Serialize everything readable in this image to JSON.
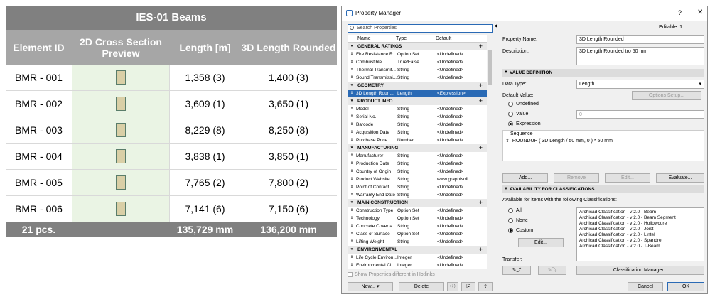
{
  "schedule": {
    "title": "IES-01 Beams",
    "headers": [
      "Element ID",
      "2D Cross Section Preview",
      "Length [m]",
      "3D Length Rounded"
    ],
    "rows": [
      {
        "id": "BMR - 001",
        "length": "1,358 (3)",
        "rounded": "1,400 (3)"
      },
      {
        "id": "BMR - 002",
        "length": "3,609 (1)",
        "rounded": "3,650 (1)"
      },
      {
        "id": "BMR - 003",
        "length": "8,229 (8)",
        "rounded": "8,250 (8)"
      },
      {
        "id": "BMR - 004",
        "length": "3,838 (1)",
        "rounded": "3,850 (1)"
      },
      {
        "id": "BMR - 005",
        "length": "7,765 (2)",
        "rounded": "7,800 (2)"
      },
      {
        "id": "BMR - 006",
        "length": "7,141 (6)",
        "rounded": "7,150 (6)"
      }
    ],
    "footer": {
      "count": "21 pcs.",
      "length_total": "135,729 mm",
      "rounded_total": "136,200 mm"
    }
  },
  "dialog": {
    "title": "Property Manager",
    "help": "?",
    "close": "✕",
    "search_placeholder": "Search Properties",
    "columns": {
      "name": "Name",
      "type": "Type",
      "default": "Default"
    },
    "groups": [
      {
        "label": "GENERAL RATINGS",
        "items": [
          {
            "name": "Fire Resistance R...",
            "type": "Option Set",
            "default": "<Undefined>"
          },
          {
            "name": "Combustible",
            "type": "True/False",
            "default": "<Undefined>"
          },
          {
            "name": "Thermal Transmit...",
            "type": "String",
            "default": "<Undefined>"
          },
          {
            "name": "Sound Transmissi...",
            "type": "String",
            "default": "<Undefined>"
          }
        ]
      },
      {
        "label": "GEOMETRY",
        "items": [
          {
            "name": "3D Length Roun...",
            "type": "Length",
            "default": "<Expression>",
            "selected": true
          }
        ]
      },
      {
        "label": "PRODUCT INFO",
        "items": [
          {
            "name": "Model",
            "type": "String",
            "default": "<Undefined>"
          },
          {
            "name": "Serial No.",
            "type": "String",
            "default": "<Undefined>"
          },
          {
            "name": "Barcode",
            "type": "String",
            "default": "<Undefined>"
          },
          {
            "name": "Acquisition Date",
            "type": "String",
            "default": "<Undefined>"
          },
          {
            "name": "Purchase Price",
            "type": "Number",
            "default": "<Undefined>"
          }
        ]
      },
      {
        "label": "MANUFACTURING",
        "items": [
          {
            "name": "Manufacturer",
            "type": "String",
            "default": "<Undefined>"
          },
          {
            "name": "Production Date",
            "type": "String",
            "default": "<Undefined>"
          },
          {
            "name": "Country of Origin",
            "type": "String",
            "default": "<Undefined>"
          },
          {
            "name": "Product Website",
            "type": "String",
            "default": "www.graphisoft...."
          },
          {
            "name": "Point of Contact",
            "type": "String",
            "default": "<Undefined>"
          },
          {
            "name": "Warranty End Date",
            "type": "String",
            "default": "<Undefined>"
          }
        ]
      },
      {
        "label": "MAIN CONSTRUCTION",
        "items": [
          {
            "name": "Construction Type",
            "type": "Option Set",
            "default": "<Undefined>"
          },
          {
            "name": "Technology",
            "type": "Option Set",
            "default": "<Undefined>"
          },
          {
            "name": "Concrete Cover a...",
            "type": "String",
            "default": "<Undefined>"
          },
          {
            "name": "Class of Surface",
            "type": "Option Set",
            "default": "<Undefined>"
          },
          {
            "name": "Lifting Weight",
            "type": "String",
            "default": "<Undefined>"
          }
        ]
      },
      {
        "label": "ENVIRONMENTAL",
        "items": [
          {
            "name": "Life Cycle Environ...",
            "type": "Integer",
            "default": "<Undefined>"
          },
          {
            "name": "Environmental Cl...",
            "type": "Integer",
            "default": "<Undefined>"
          }
        ]
      }
    ],
    "show_hotlinks": "Show Properties different in Hotlinks",
    "new_button": "New...",
    "delete_button": "Delete",
    "editable": "Editable: 1",
    "property_name_label": "Property Name:",
    "property_name_value": "3D Length Rounded",
    "description_label": "Description:",
    "description_value": "3D Length Rounded tro 50 mm",
    "value_definition": "VALUE DEFINITION",
    "data_type_label": "Data Type:",
    "data_type_value": "Length",
    "default_value_label": "Default Value:",
    "options_setup": "Options Setup...",
    "radio_undefined": "Undefined",
    "radio_value": "Value",
    "value_field": "0",
    "radio_expression": "Expression",
    "sequence_header": "Sequence",
    "sequence_expr": "ROUNDUP ( 3D Length / 50 mm, 0 ) * 50 mm",
    "add_button": "Add...",
    "remove_button": "Remove",
    "edit_button": "Edit...",
    "evaluate_button": "Evaluate...",
    "availability": "AVAILABILITY FOR CLASSIFICATIONS",
    "available_text": "Available for items with the following Classifications:",
    "radio_all": "All",
    "radio_none": "None",
    "radio_custom": "Custom",
    "edit_custom": "Edit...",
    "classifications": [
      "Archicad Classification - v 2.0 - Beam",
      "Archicad Classification - v 2.0 - Beam Segment",
      "Archicad Classification - v 2.0 - Hollowcore",
      "Archicad Classification - v 2.0 - Joist",
      "Archicad Classification - v 2.0 - Lintel",
      "Archicad Classification - v 2.0 - Spandrel",
      "Archicad Classification - v 2.0 - T-Beam"
    ],
    "transfer_label": "Transfer:",
    "classification_manager": "Classification Manager...",
    "cancel_button": "Cancel",
    "ok_button": "OK"
  }
}
